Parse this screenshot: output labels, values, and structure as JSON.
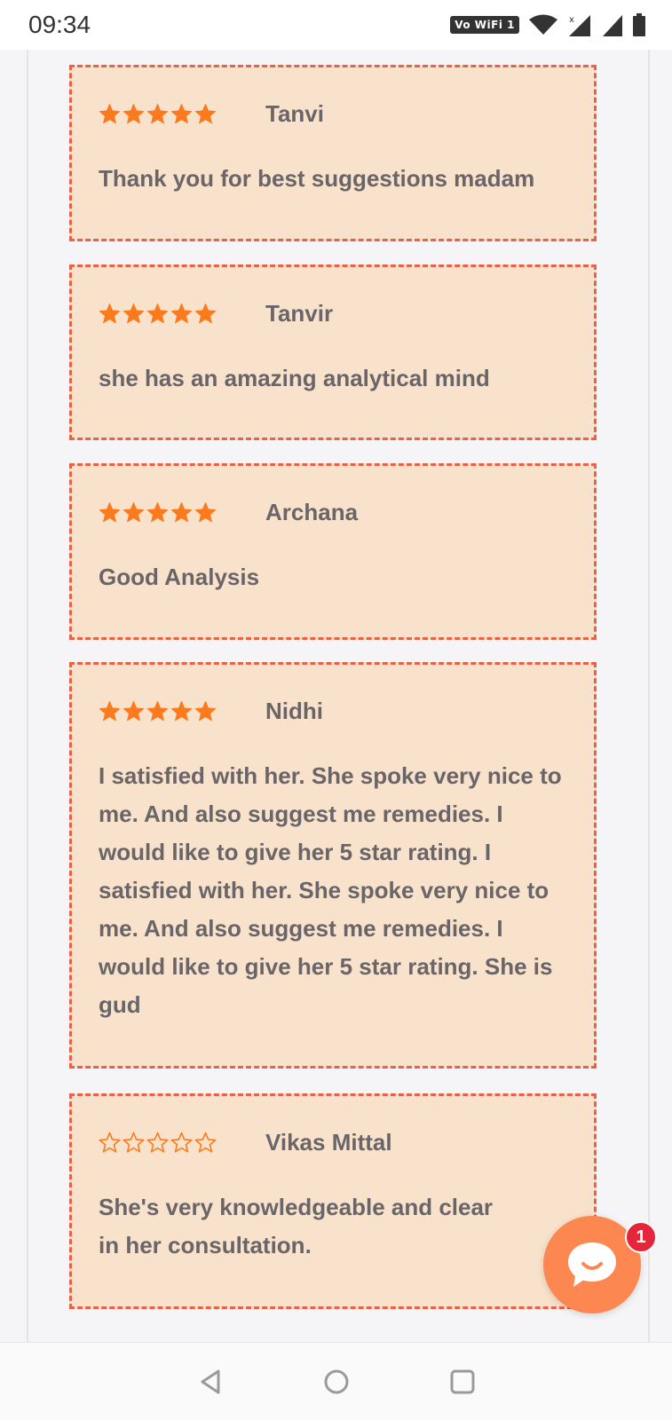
{
  "status_bar": {
    "time": "09:34",
    "network_label": "Vo WiFi 1"
  },
  "reviews": [
    {
      "name": "Tanvi",
      "rating": 5,
      "text": "Thank you for best suggestions madam"
    },
    {
      "name": "Tanvir",
      "rating": 5,
      "text": "she has an amazing analytical mind"
    },
    {
      "name": "Archana",
      "rating": 5,
      "text": "Good Analysis"
    },
    {
      "name": "Nidhi",
      "rating": 5,
      "text": "I satisfied with her. She spoke very nice to me. And also suggest me remedies. I would like to give her 5 star rating. I satisfied with her. She spoke very nice to me. And also suggest me remedies. I would like to give her 5 star rating. She is gud"
    },
    {
      "name": "Vikas Mittal",
      "rating": 0,
      "text": "She's very knowledgeable and clear in her consultation."
    }
  ],
  "chat_widget": {
    "badge_count": "1"
  },
  "colors": {
    "star_fill": "#fb7a1e",
    "card_bg": "#f9e2cb",
    "card_border": "#e8624a",
    "chat_bg": "#fc8750",
    "badge_bg": "#e5263a"
  },
  "icons": {
    "nav_back": "back-triangle-icon",
    "nav_home": "home-circle-icon",
    "nav_recents": "recents-square-icon",
    "chat": "chat-bubble-icon"
  }
}
